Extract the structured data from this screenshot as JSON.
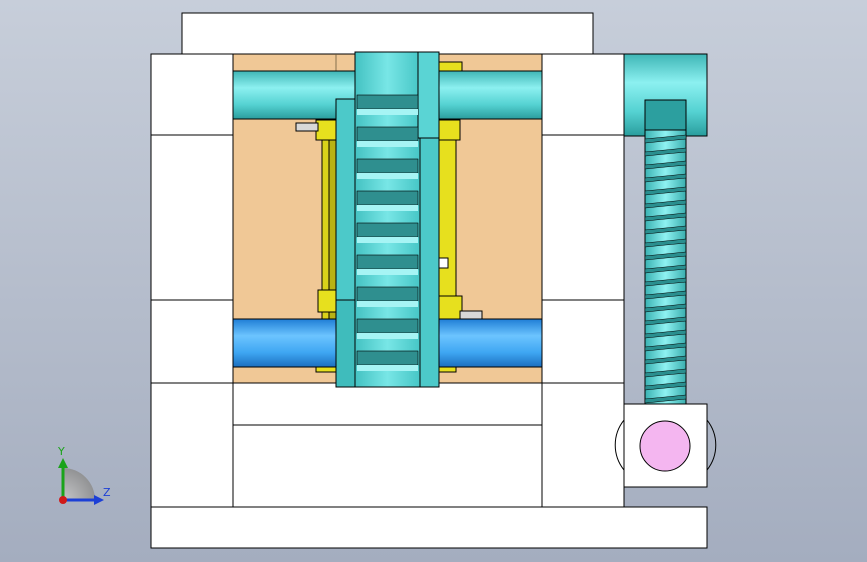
{
  "viewport": {
    "background_top": "#c7ceda",
    "background_bottom": "#a4adbf"
  },
  "triad": {
    "y_label": "Y",
    "z_label": "Z",
    "y_axis_color": "#1aa31a",
    "z_axis_color": "#1c3fd6",
    "origin_color": "#d01a1a"
  },
  "model": {
    "frame_color": "#ffffff",
    "cavity_color": "#f0c896",
    "cyan_color": "#5fd8d8",
    "blue_color": "#3ea6f2",
    "yellow_color": "#e7e01e",
    "pink_color": "#f4b6f0",
    "gear_tooth_count": 9,
    "worm_thread_count": 21
  }
}
